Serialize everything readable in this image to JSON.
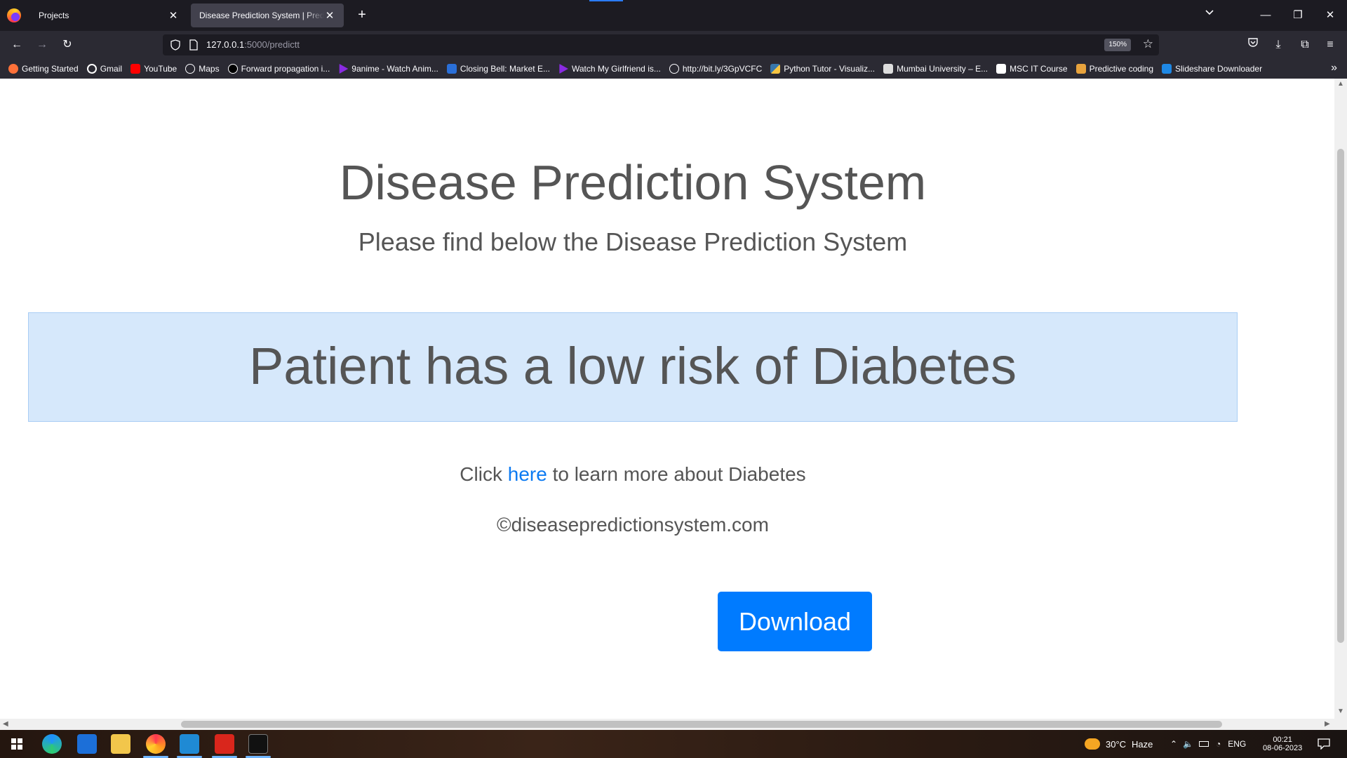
{
  "browser": {
    "tabs": [
      {
        "label": "Projects",
        "active": false
      },
      {
        "label": "Disease Prediction System | Prediction",
        "active": true
      }
    ],
    "url_host": "127.0.0.1",
    "url_path": ":5000/predictt",
    "zoom": "150%",
    "bookmarks": [
      {
        "label": "Getting Started",
        "icon": "firefox-icon",
        "color": "#ff7139"
      },
      {
        "label": "Gmail",
        "icon": "google-icon",
        "color": "#ffffff"
      },
      {
        "label": "YouTube",
        "icon": "youtube-icon",
        "color": "#ff0000"
      },
      {
        "label": "Maps",
        "icon": "globe-icon",
        "color": "#fbfbfe"
      },
      {
        "label": "Forward propagation i...",
        "icon": "medium-icon",
        "color": "#000000"
      },
      {
        "label": "9anime - Watch Anim...",
        "icon": "play-icon",
        "color": "#8a2be2"
      },
      {
        "label": "Closing Bell: Market E...",
        "icon": "news-icon",
        "color": "#2a6fd8"
      },
      {
        "label": "Watch My Girlfriend is...",
        "icon": "play-icon",
        "color": "#8a2be2"
      },
      {
        "label": "http://bit.ly/3GpVCFC",
        "icon": "globe-icon",
        "color": "#fbfbfe"
      },
      {
        "label": "Python Tutor - Visualiz...",
        "icon": "python-icon",
        "color": "#f5c542"
      },
      {
        "label": "Mumbai University – E...",
        "icon": "university-icon",
        "color": "#dddddd"
      },
      {
        "label": "MSC IT Course",
        "icon": "it-icon",
        "color": "#ffffff"
      },
      {
        "label": "Predictive coding",
        "icon": "doc-icon",
        "color": "#e8a33d"
      },
      {
        "label": "Slideshare Downloader",
        "icon": "slideshare-icon",
        "color": "#1e88e5"
      }
    ]
  },
  "page": {
    "title": "Disease Prediction System",
    "subtitle": "Please find below the Disease Prediction System",
    "result": "Patient has a low risk of Diabetes",
    "learn_prefix": "Click ",
    "learn_link": "here",
    "learn_suffix": " to learn more about Diabetes",
    "copyright": "©diseasepredictionsystem.com",
    "download_label": "Download"
  },
  "taskbar": {
    "weather_temp": "30°C",
    "weather_desc": "Haze",
    "language": "ENG",
    "time": "00:21",
    "date": "08-06-2023"
  }
}
